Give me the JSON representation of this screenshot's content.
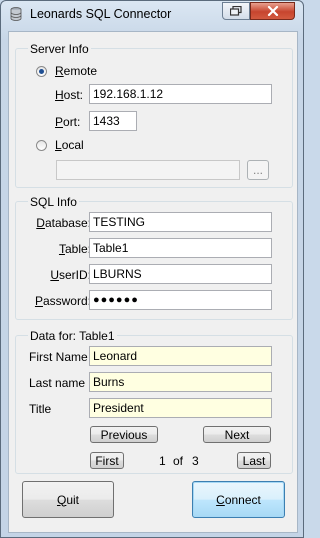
{
  "window": {
    "title": "Leonards SQL Connector"
  },
  "server_info": {
    "legend": "Server Info",
    "remote_label_u": "R",
    "remote_label_rest": "emote",
    "host_label_u": "H",
    "host_label_rest": "ost:",
    "host_value": "192.168.1.12",
    "port_label_u": "P",
    "port_label_rest": "ort:",
    "port_value": "1433",
    "local_label_u": "L",
    "local_label_rest": "ocal",
    "local_path_value": "",
    "browse_label": "..."
  },
  "sql_info": {
    "legend": "SQL Info",
    "database_label_u": "D",
    "database_label_rest": "atabase:",
    "database_value": "TESTING",
    "table_label_u": "T",
    "table_label_rest": "able:",
    "table_value": "Table1",
    "userid_label_u": "U",
    "userid_label_rest": "serID:",
    "userid_value": "LBURNS",
    "password_label_u": "P",
    "password_label_rest": "assword:",
    "password_value": "●●●●●●"
  },
  "data": {
    "legend": "Data for: Table1",
    "first_name_label": "First Name",
    "first_name_value": "Leonard",
    "last_name_label": "Last name",
    "last_name_value": "Burns",
    "title_label": "Title",
    "title_value": "President",
    "previous_label": "Previous",
    "next_label": "Next",
    "first_label": "First",
    "last_label": "Last",
    "record_current": "1",
    "record_of": "of",
    "record_total": "3"
  },
  "buttons": {
    "quit_label_u": "Q",
    "quit_label_rest": "uit",
    "connect_label_u": "C",
    "connect_label_rest": "onnect"
  },
  "server_mode": "remote",
  "icons": [
    "app-icon",
    "restore-icon",
    "close-icon"
  ]
}
